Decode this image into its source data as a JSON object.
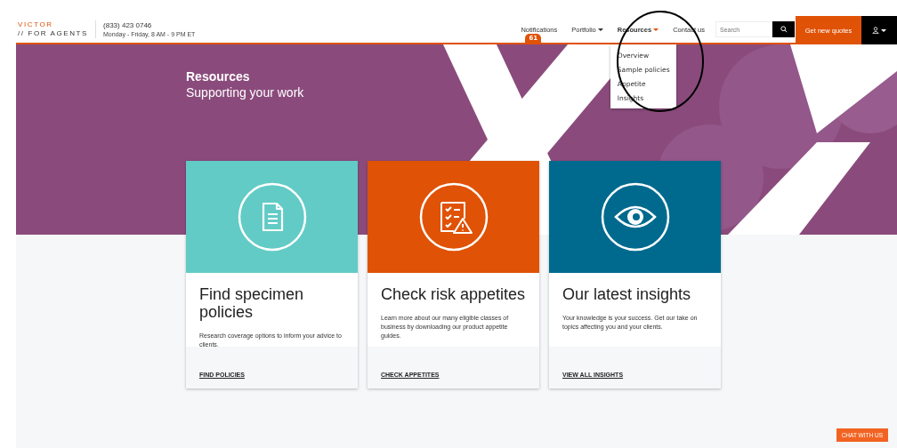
{
  "brand": {
    "line_1": "VICTOR",
    "line_2": "// FOR AGENTS"
  },
  "contact": {
    "phone": "(833) 423 0746",
    "hours": "Monday - Friday, 8 AM - 9 PM ET"
  },
  "nav": [
    {
      "label": "Notifications",
      "kind": "link",
      "badge": "61",
      "expanded": false
    },
    {
      "label": "Portfolio",
      "kind": "dropdown",
      "expanded": false
    },
    {
      "label": "Resources",
      "kind": "dropdown",
      "expanded": true,
      "menu": [
        "Overview",
        "Sample policies",
        "Appetite",
        "Insights"
      ]
    },
    {
      "label": "Contact us",
      "kind": "link",
      "expanded": false
    }
  ],
  "search": {
    "placeholder": "Search"
  },
  "quote_button": "Get new quotes",
  "hero": {
    "title": "Resources",
    "subtitle": "Supporting your work"
  },
  "cards": [
    {
      "kind": "document",
      "color": "#62cbc6",
      "title": "Find specimen policies",
      "text": "Research coverage options to inform your advice to clients.",
      "link": "FIND POLICIES"
    },
    {
      "kind": "checklist",
      "color": "#e05206",
      "title": "Check risk appetites",
      "text": "Learn more about our many eligible classes of business by downloading our product appetite guides.",
      "link": "CHECK APPETITES"
    },
    {
      "kind": "eye",
      "color": "#006a8e",
      "title": "Our latest insights",
      "text": "Your knowledge is your success. Get our take on topics affecting you and your clients.",
      "link": "VIEW ALL INSIGHTS"
    }
  ],
  "chat_button": "CHAT WITH US"
}
